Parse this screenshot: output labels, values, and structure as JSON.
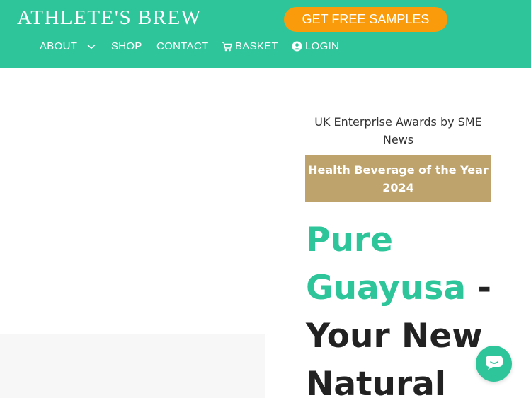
{
  "header": {
    "brand": "ATHLETE'S BREW",
    "cta_label": "GET FREE SAMPLES",
    "nav": {
      "about": "ABOUT",
      "shop": "SHOP",
      "contact": "CONTACT",
      "basket": "BASKET",
      "login": "LOGIN"
    }
  },
  "award": {
    "caption": "UK Enterprise Awards by SME News",
    "title": "Health Beverage of the Year 2024"
  },
  "hero": {
    "headline_accent": "Pure Guayusa",
    "headline_rest": " - Your New Natural"
  },
  "icons": {
    "about_dropdown": "chevron-down-icon",
    "basket": "cart-icon",
    "login": "user-circle-icon",
    "chat": "chat-icon"
  },
  "colors": {
    "brand_green": "#2ec59a",
    "cta_orange": "#f99b0b",
    "award_gold": "#bfa36d"
  }
}
